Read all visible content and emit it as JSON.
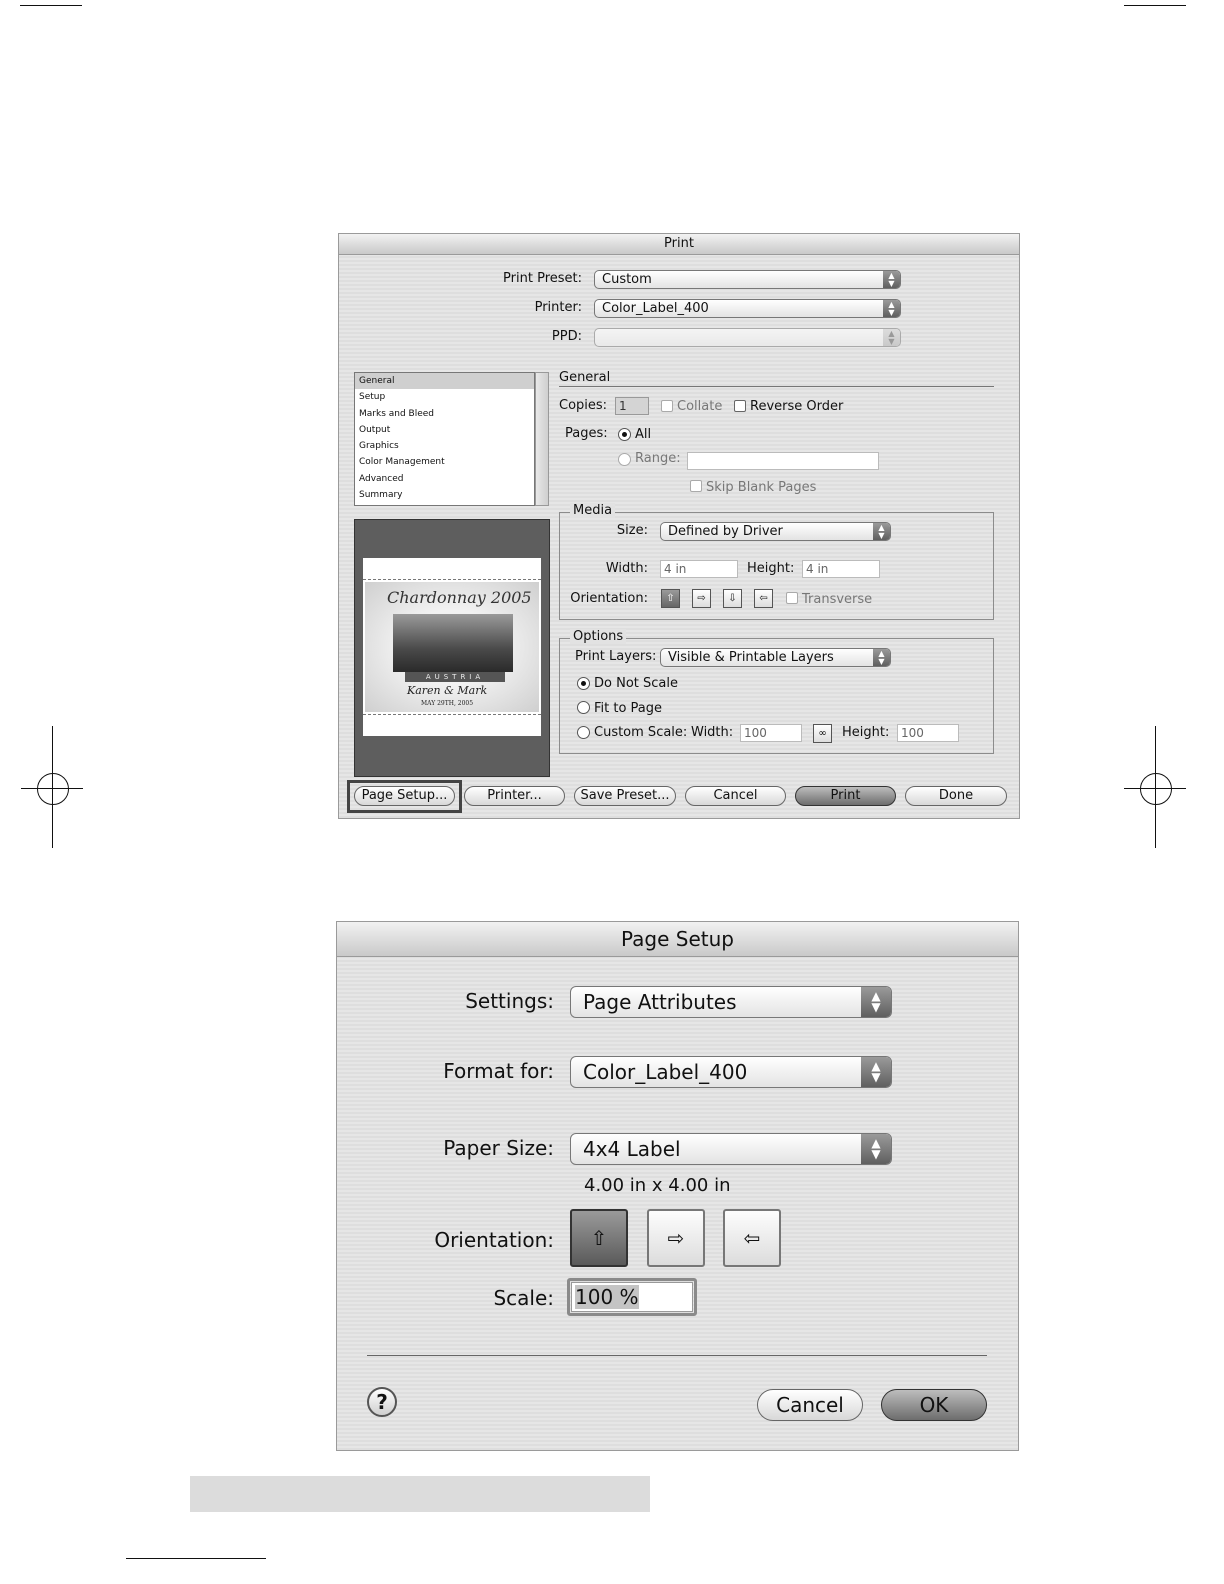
{
  "print_dialog": {
    "title": "Print",
    "print_preset": {
      "label": "Print Preset:",
      "value": "Custom"
    },
    "printer": {
      "label": "Printer:",
      "value": "Color_Label_400"
    },
    "ppd": {
      "label": "PPD:",
      "value": ""
    },
    "categories": [
      "General",
      "Setup",
      "Marks and Bleed",
      "Output",
      "Graphics",
      "Color Management",
      "Advanced",
      "Summary"
    ],
    "selected_category": "General",
    "section_title": "General",
    "copies": {
      "label": "Copies:",
      "value": "1"
    },
    "collate": "Collate",
    "reverse_order": "Reverse Order",
    "pages": {
      "label": "Pages:",
      "all": "All",
      "range": "Range:",
      "range_value": ""
    },
    "skip_blank": "Skip Blank Pages",
    "media": {
      "title": "Media",
      "size_label": "Size:",
      "size_value": "Defined by Driver",
      "width_label": "Width:",
      "width_value": "4 in",
      "height_label": "Height:",
      "height_value": "4 in",
      "orientation_label": "Orientation:",
      "transverse": "Transverse"
    },
    "options": {
      "title": "Options",
      "print_layers_label": "Print Layers:",
      "print_layers_value": "Visible & Printable Layers",
      "do_not_scale": "Do Not Scale",
      "fit_to_page": "Fit to Page",
      "custom_scale": "Custom Scale:",
      "width_label": "Width:",
      "width_value": "100",
      "height_label": "Height:",
      "height_value": "100"
    },
    "preview": {
      "headline": "Chardonnay 2005",
      "banner": "AUSTRIA",
      "names": "Karen & Mark",
      "date": "MAY 29TH, 2005"
    },
    "buttons": {
      "page_setup": "Page Setup...",
      "printer": "Printer...",
      "save_preset": "Save Preset...",
      "cancel": "Cancel",
      "print": "Print",
      "done": "Done"
    }
  },
  "page_setup_dialog": {
    "title": "Page Setup",
    "settings": {
      "label": "Settings:",
      "value": "Page Attributes"
    },
    "format_for": {
      "label": "Format for:",
      "value": "Color_Label_400"
    },
    "paper_size": {
      "label": "Paper Size:",
      "value": "4x4 Label",
      "dimensions": "4.00 in x 4.00 in"
    },
    "orientation_label": "Orientation:",
    "scale": {
      "label": "Scale:",
      "value": "100 %"
    },
    "help": "?",
    "buttons": {
      "cancel": "Cancel",
      "ok": "OK"
    }
  }
}
